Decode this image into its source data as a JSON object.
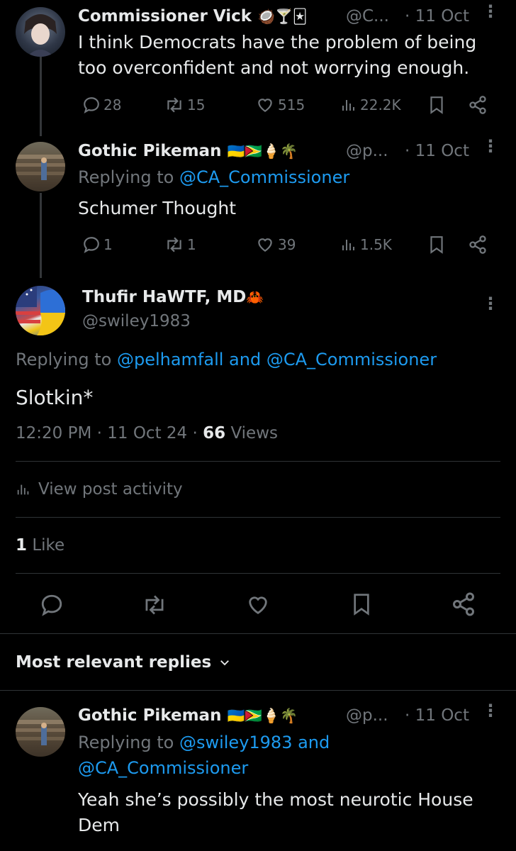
{
  "posts": [
    {
      "name": "Commissioner Vick",
      "emojis": "🥥🍸🃏",
      "handle": "@C...",
      "date": "· 11 Oct",
      "text": "I think Democrats have the problem of being too overconfident and not worrying enough.",
      "replies": "28",
      "reposts": "15",
      "likes": "515",
      "views": "22.2K"
    },
    {
      "name": "Gothic Pikeman",
      "emojis": "🇺🇦🇬🇾🍦🌴",
      "handle": "@p...",
      "date": "· 11 Oct",
      "replying_prefix": "Replying to",
      "replying_to": "@CA_Commissioner",
      "text": "Schumer Thought",
      "replies": "1",
      "reposts": "1",
      "likes": "39",
      "views": "1.5K"
    }
  ],
  "main_post": {
    "name": "Thufir HaWTF, MD",
    "emoji": "🦀",
    "handle": "@swiley1983",
    "replying_prefix": "Replying to",
    "replying_to": "@pelhamfall and @CA_Commissioner",
    "text": "Slotkin*",
    "timestamp": "12:20 PM · 11 Oct 24 · ",
    "views_count": "66",
    "views_label": "Views",
    "post_activity": "View post activity",
    "likes_count": "1",
    "likes_label": "Like"
  },
  "replies_section": {
    "title": "Most relevant replies"
  },
  "reply": {
    "name": "Gothic Pikeman",
    "emojis": "🇺🇦🇬🇾🍦🌴",
    "handle": "@p...",
    "date": "· 11 Oct",
    "replying_prefix": "Replying to",
    "replying_to_line1": "@swiley1983 and",
    "replying_to_line2": "@CA_Commissioner",
    "text": "Yeah she’s possibly the most neurotic House Dem"
  },
  "colors": {
    "background": "#000000",
    "text": "#e7e9ea",
    "muted": "#71767b",
    "link": "#1d9bf0",
    "divider": "#2f3336"
  }
}
